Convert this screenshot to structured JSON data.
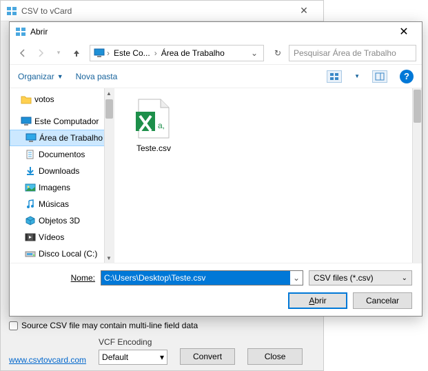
{
  "parent": {
    "title": "CSV to vCard",
    "checkbox_label": "Source CSV file may contain multi-line field data",
    "link": "www.csvtovcard.com",
    "vcf_label": "VCF Encoding",
    "vcf_value": "Default",
    "convert_btn": "Convert",
    "close_btn": "Close"
  },
  "dialog": {
    "title": "Abrir",
    "breadcrumb": {
      "seg1": "Este Co...",
      "seg2": "Área de Trabalho"
    },
    "search_placeholder": "Pesquisar Área de Trabalho",
    "toolbar": {
      "organize": "Organizar",
      "new_folder": "Nova pasta"
    },
    "tree": {
      "votos": "votos",
      "computer": "Este Computador",
      "desktop": "Área de Trabalho",
      "documents": "Documentos",
      "downloads": "Downloads",
      "images": "Imagens",
      "music": "Músicas",
      "objects3d": "Objetos 3D",
      "videos": "Vídeos",
      "localdisk": "Disco Local (C:)"
    },
    "file": {
      "name": "Teste.csv"
    },
    "name_label_pre": "N",
    "name_label_ul": "o",
    "name_label_post": "me:",
    "name_value": "C:\\Users\\Desktop\\Teste.csv",
    "filter": "CSV files (*.csv)",
    "open_btn_ul": "A",
    "open_btn_rest": "brir",
    "cancel_btn": "Cancelar"
  }
}
